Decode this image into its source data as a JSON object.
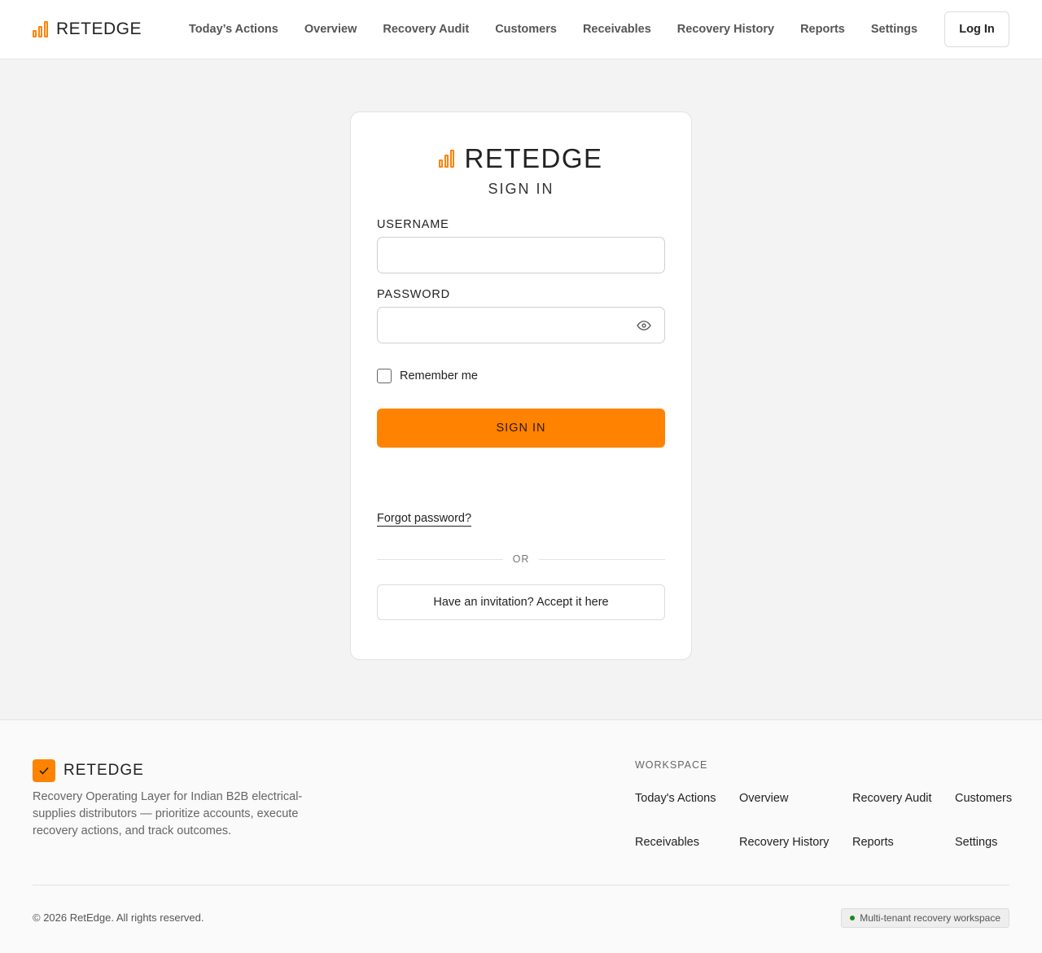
{
  "header": {
    "brand": "RETEDGE",
    "nav": [
      "Today’s Actions",
      "Overview",
      "Recovery Audit",
      "Customers",
      "Receivables",
      "Recovery History",
      "Reports",
      "Settings"
    ],
    "login_label": "Log In"
  },
  "login": {
    "brand": "RETEDGE",
    "subtitle": "SIGN IN",
    "username_label": "USERNAME",
    "username_value": "",
    "password_label": "PASSWORD",
    "password_value": "",
    "remember_label": "Remember me",
    "remember_checked": false,
    "submit_label": "SIGN IN",
    "forgot_label": "Forgot password?",
    "divider_label": "OR",
    "invite_label": "Have an invitation? Accept it here"
  },
  "footer": {
    "brand": "RETEDGE",
    "description": "Recovery Operating Layer for Indian B2B electrical-supplies distributors — prioritize accounts, execute recovery actions, and track outcomes.",
    "workspace_title": "WORKSPACE",
    "workspace_links": [
      "Today's Actions",
      "Overview",
      "Recovery Audit",
      "Customers",
      "Receivables",
      "Recovery History",
      "Reports",
      "Settings"
    ],
    "copyright": "© 2026 RetEdge. All rights reserved.",
    "status_badge": "Multi-tenant recovery workspace"
  },
  "colors": {
    "accent": "#ff8200",
    "status_dot": "#1a8a1a"
  },
  "icons": {
    "brand": "bar-chart-icon",
    "password_toggle": "eye-icon",
    "footer_logo": "checkmark-icon"
  }
}
